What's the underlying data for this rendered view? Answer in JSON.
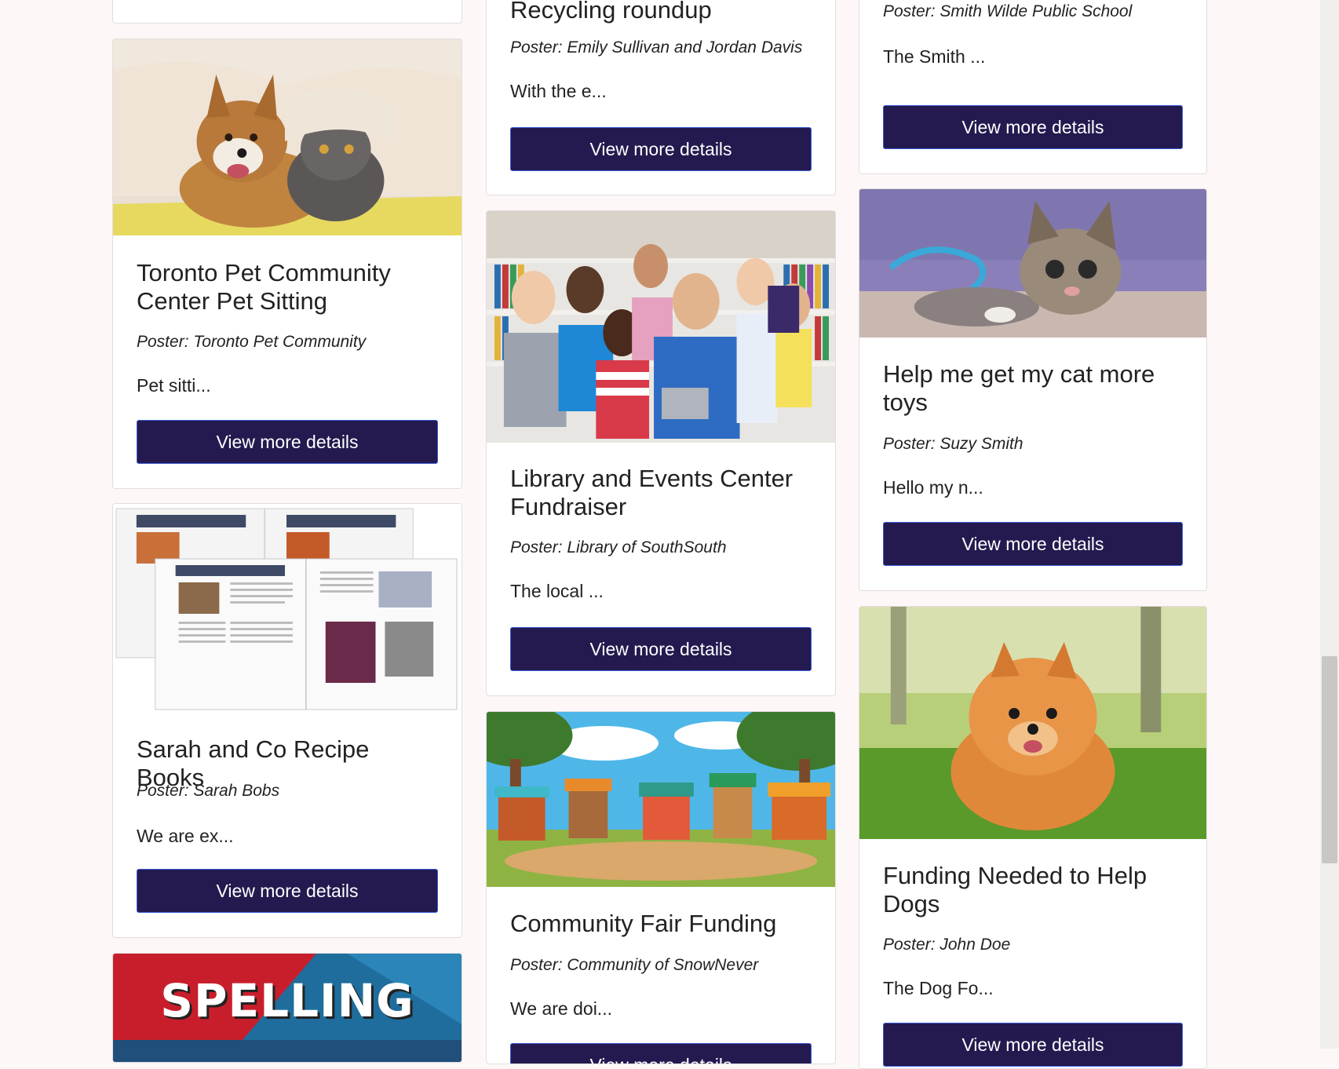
{
  "button_label": "View more details",
  "column1": {
    "card_pet": {
      "title": "Toronto Pet Community Center Pet Sitting",
      "poster": "Poster: Toronto Pet Community",
      "excerpt": "Pet sitti...",
      "image": "dog-and-cat-under-blanket"
    },
    "card_recipe": {
      "title": "Sarah and Co Recipe Books",
      "poster": "Poster: Sarah Bobs",
      "excerpt": "We are ex...",
      "image": "open-recipe-books"
    },
    "card_spelling": {
      "image_text": "SPELLING",
      "image": "spelling-bee-banner"
    }
  },
  "column2": {
    "card_recycling": {
      "title": "Recycling roundup",
      "poster": "Poster: Emily Sullivan and Jordan Davis",
      "excerpt": "With the e..."
    },
    "card_library": {
      "title": "Library and Events Center Fundraiser",
      "poster": "Poster: Library of SouthSouth",
      "excerpt": "The local ...",
      "image": "children-with-teacher-in-library"
    },
    "card_fair": {
      "title": "Community Fair Funding",
      "poster": "Poster: Community of SnowNever",
      "excerpt": "We are doi...",
      "image": "cartoon-market-stalls"
    }
  },
  "column3": {
    "card_school": {
      "poster": "Poster: Smith Wilde Public School",
      "excerpt": "The Smith ..."
    },
    "card_cat": {
      "title": "Help me get my cat more toys",
      "poster": "Poster: Suzy Smith",
      "excerpt": "Hello my n...",
      "image": "kitten-playing"
    },
    "card_dogs": {
      "title": "Funding Needed to Help Dogs",
      "poster": "Poster: John Doe",
      "excerpt": "The Dog Fo...",
      "image": "pomeranian-on-grass"
    }
  },
  "colors": {
    "button_bg": "#241a4f",
    "button_border": "#3b5bd6",
    "page_bg": "#fdf7f7"
  }
}
